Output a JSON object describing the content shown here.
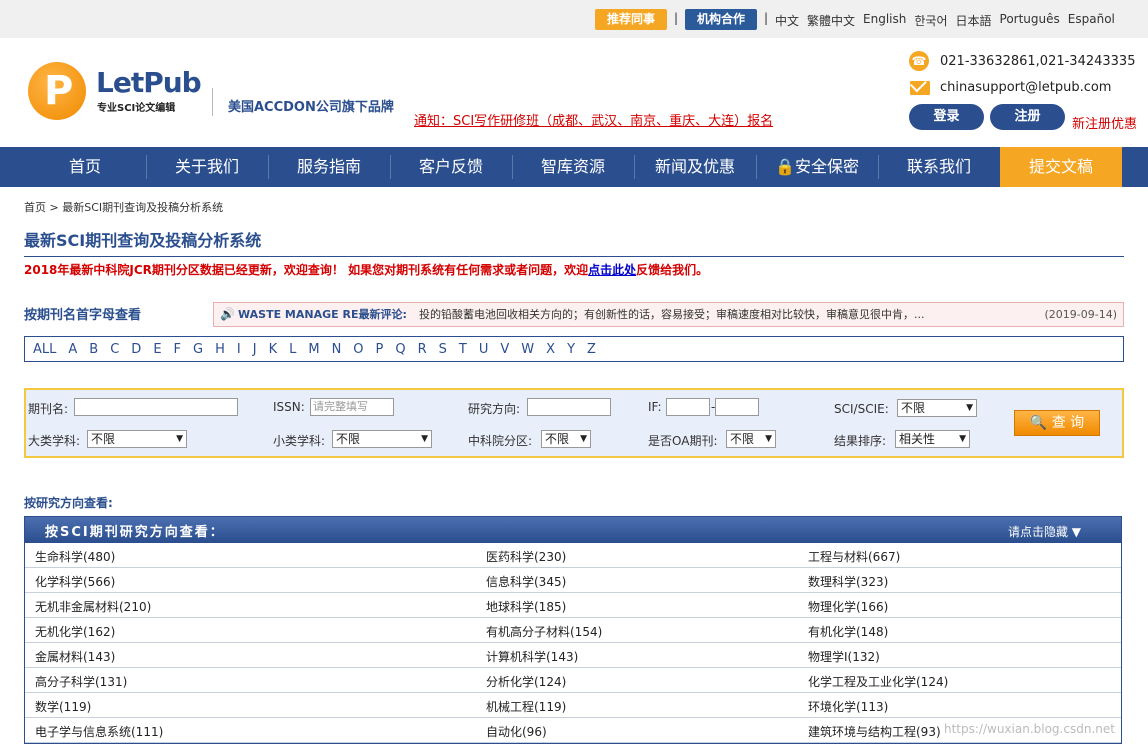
{
  "topbar": {
    "recommend_label": "推荐同事",
    "org_label": "机构合作",
    "languages": [
      "中文",
      "繁體中文",
      "English",
      "한국어",
      "日本語",
      "Português",
      "Español"
    ]
  },
  "header": {
    "logo_letter": "P",
    "logo_name": "LetPub",
    "logo_sub": "专业SCI论文编辑",
    "brand": "美国ACCDON公司旗下品牌",
    "notice": "通知：SCI写作研修班（成都、武汉、南京、重庆、大连）报名",
    "phone": "021-33632861,021-34243335",
    "email": "chinasupport@letpub.com",
    "login_label": "登录",
    "register_label": "注册",
    "new_register": "新注册优惠"
  },
  "nav": [
    "首页",
    "关于我们",
    "服务指南",
    "客户反馈",
    "智库资源",
    "新闻及优惠",
    "安全保密",
    "联系我们",
    "提交文稿"
  ],
  "breadcrumb": "首页 > 最新SCI期刊查询及投稿分析系统",
  "page_title": "最新SCI期刊查询及投稿分析系统",
  "alert": {
    "text1": "2018年最新中科院JCR期刊分区数据已经更新，欢迎查询！ 如果您对期刊系统有任何需求或者问题，欢迎",
    "link": "点击此处",
    "text2": "反馈给我们。"
  },
  "letter_search": {
    "label": "按期刊名首字母查看",
    "review_journal": "WASTE MANAGE RE最新评论:",
    "review_text": "投的铅酸蓄电池回收相关方向的；有创新性的话，容易接受；审稿速度相对比较快，审稿意见很中肯，...",
    "review_date": "(2019-09-14)",
    "letters": [
      "ALL",
      "A",
      "B",
      "C",
      "D",
      "E",
      "F",
      "G",
      "H",
      "I",
      "J",
      "K",
      "L",
      "M",
      "N",
      "O",
      "P",
      "Q",
      "R",
      "S",
      "T",
      "U",
      "V",
      "W",
      "X",
      "Y",
      "Z"
    ]
  },
  "form": {
    "journal_name": "期刊名:",
    "issn": "ISSN:",
    "issn_placeholder": "请完整填写",
    "research": "研究方向:",
    "if": "IF:",
    "sci": "SCI/SCIE:",
    "sci_value": "不限",
    "major": "大类学科:",
    "major_value": "不限",
    "minor": "小类学科:",
    "minor_value": "不限",
    "cas": "中科院分区:",
    "cas_value": "不限",
    "oa": "是否OA期刊:",
    "oa_value": "不限",
    "sort": "结果排序:",
    "sort_value": "相关性",
    "query_label": "查 询"
  },
  "research": {
    "label": "按研究方向查看:",
    "header_title": "按SCI期刊研究方向查看：",
    "hide_label": "请点击隐藏 ▼",
    "rows": [
      [
        "生命科学(480)",
        "医药科学(230)",
        "工程与材料(667)"
      ],
      [
        "化学科学(566)",
        "信息科学(345)",
        "数理科学(323)"
      ],
      [
        "无机非金属材料(210)",
        "地球科学(185)",
        "物理化学(166)"
      ],
      [
        "无机化学(162)",
        "有机高分子材料(154)",
        "有机化学(148)"
      ],
      [
        "金属材料(143)",
        "计算机科学(143)",
        "物理学I(132)"
      ],
      [
        "高分子科学(131)",
        "分析化学(124)",
        "化学工程及工业化学(124)"
      ],
      [
        "数学(119)",
        "机械工程(119)",
        "环境化学(113)"
      ],
      [
        "电子学与信息系统(111)",
        "自动化(96)",
        "建筑环境与结构工程(93)"
      ]
    ]
  },
  "watermark": "https://wuxian.blog.csdn.net"
}
